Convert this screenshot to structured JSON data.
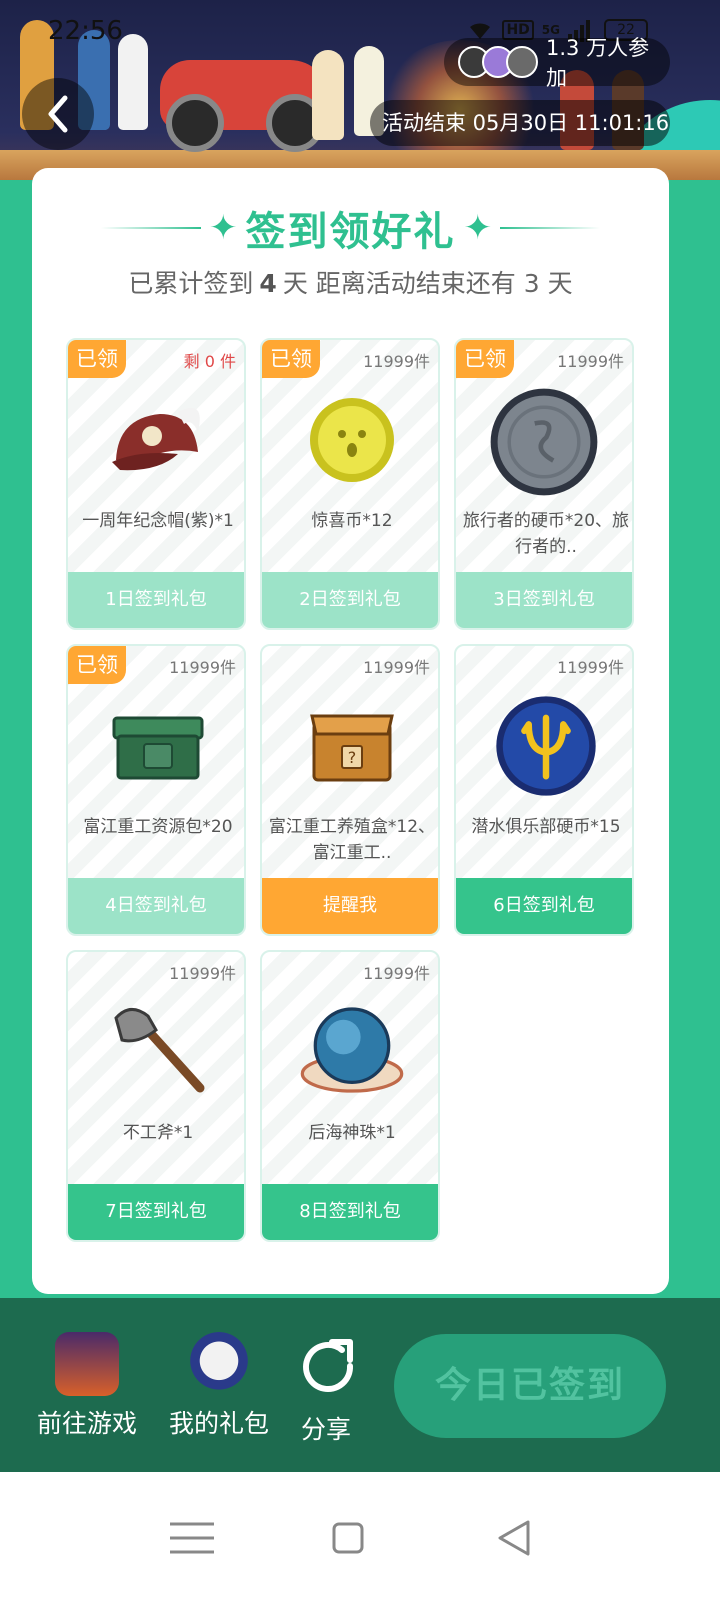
{
  "status_bar": {
    "time": "22:56",
    "network": "5G",
    "hd": "HD",
    "battery": "22"
  },
  "header": {
    "participants": "1.3 万人参加",
    "ends": "活动结束 05月30日 11:01:16"
  },
  "card": {
    "title": "签到领好礼",
    "subtitle_prefix": "已累计签到",
    "days_signed": "4",
    "subtitle_mid": "天  距离活动结束还有",
    "days_left": "3",
    "subtitle_suffix": "天"
  },
  "rewards": [
    {
      "claimed_label": "已领",
      "stock": "剩 0 件",
      "name": "一周年纪念帽(紫)*1",
      "button": "1日签到礼包",
      "state": "done",
      "icon": "cap-icon"
    },
    {
      "claimed_label": "已领",
      "stock": "11999件",
      "name": "惊喜币*12",
      "button": "2日签到礼包",
      "state": "done",
      "icon": "surprise-coin-icon"
    },
    {
      "claimed_label": "已领",
      "stock": "11999件",
      "name": "旅行者的硬币*20、旅行者的..",
      "button": "3日签到礼包",
      "state": "done",
      "icon": "traveler-coin-icon"
    },
    {
      "claimed_label": "已领",
      "stock": "11999件",
      "name": "富江重工资源包*20",
      "button": "4日签到礼包",
      "state": "done",
      "icon": "resource-box-icon"
    },
    {
      "claimed_label": "",
      "stock": "11999件",
      "name": "富江重工养殖盒*12、富江重工..",
      "button": "提醒我",
      "state": "remind",
      "icon": "mystery-box-icon"
    },
    {
      "claimed_label": "",
      "stock": "11999件",
      "name": "潜水俱乐部硬币*15",
      "button": "6日签到礼包",
      "state": "active",
      "icon": "trident-coin-icon"
    },
    {
      "claimed_label": "",
      "stock": "11999件",
      "name": "不工斧*1",
      "button": "7日签到礼包",
      "state": "active",
      "icon": "axe-icon"
    },
    {
      "claimed_label": "",
      "stock": "11999件",
      "name": "后海神珠*1",
      "button": "8日签到礼包",
      "state": "active",
      "icon": "pearl-icon"
    }
  ],
  "bottom_bar": {
    "goto_game": "前往游戏",
    "my_gifts": "我的礼包",
    "share": "分享",
    "checkin": "今日已签到"
  },
  "colors": {
    "accent": "#2fc090",
    "claimed": "#ffa733",
    "button_done": "#9ce3c8",
    "button_active": "#35c48c",
    "bottom_bar": "#1d6b4f"
  }
}
